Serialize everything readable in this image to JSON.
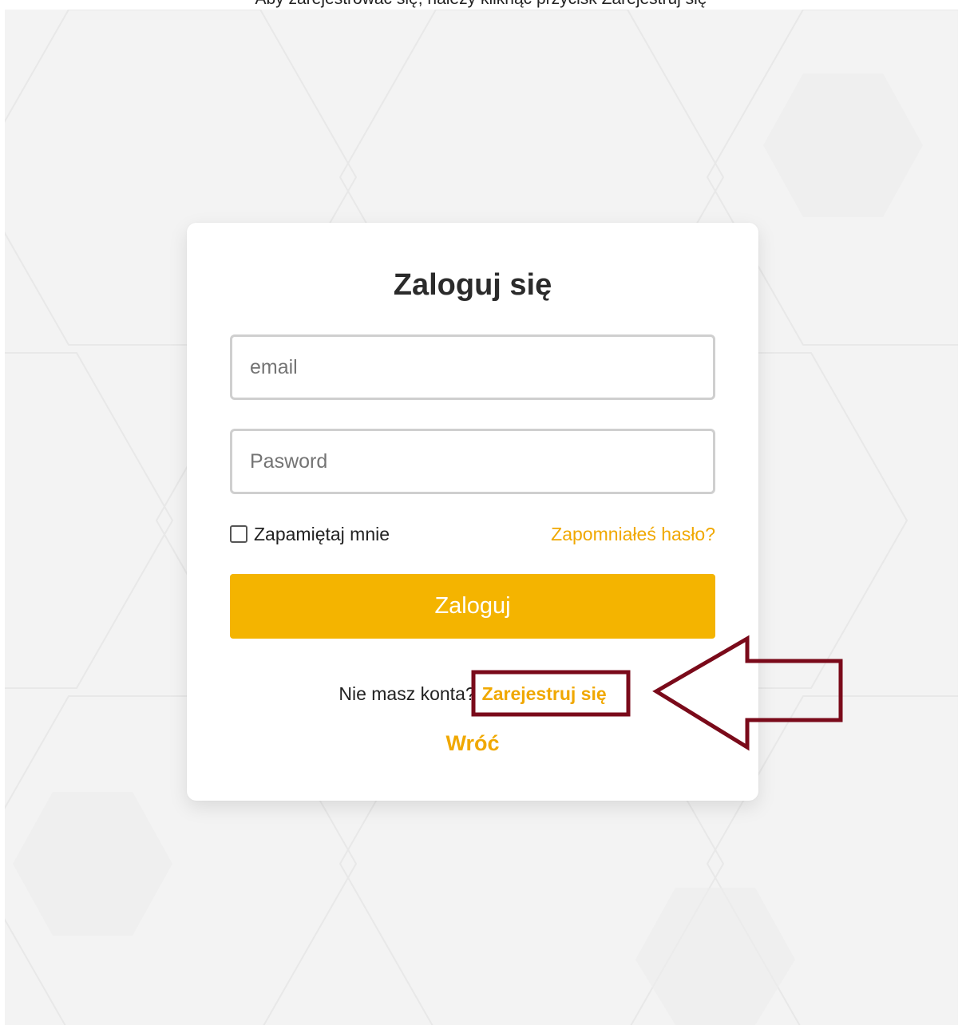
{
  "caption": "Aby zarejestrować się, należy kliknąć przycisk Zarejestruj się",
  "login": {
    "title": "Zaloguj się",
    "email_placeholder": "email",
    "password_placeholder": "Pasword",
    "remember_label": "Zapamiętaj mnie",
    "forgot_label": "Zapomniałeś hasło?",
    "submit_label": "Zaloguj",
    "no_account_text": "Nie masz konta?",
    "register_label": "Zarejestruj się",
    "back_label": "Wróć"
  },
  "colors": {
    "accent": "#f4b400",
    "link": "#f0a800",
    "annotation": "#7a0a1a",
    "background": "#f3f3f3"
  }
}
